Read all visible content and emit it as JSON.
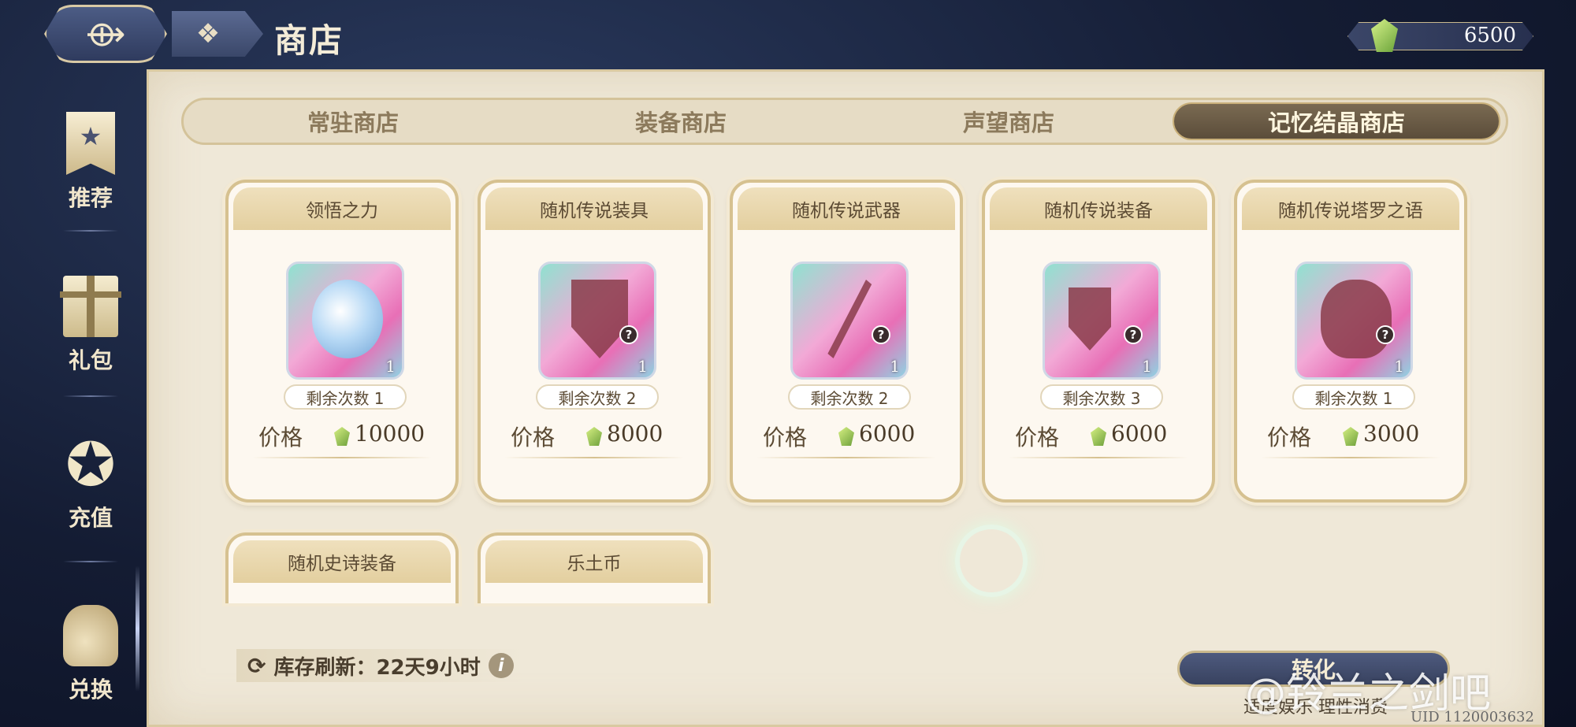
{
  "header": {
    "title": "商店",
    "back_icon": "back-arrow-icon",
    "menu_icon": "grid-icon",
    "currency": {
      "icon": "crystal-icon",
      "value": "6500",
      "color": "#9fd05a"
    }
  },
  "sidebar": {
    "items": [
      {
        "label": "推荐",
        "icon": "star-banner-icon"
      },
      {
        "label": "礼包",
        "icon": "gift-icon"
      },
      {
        "label": "充值",
        "icon": "sparkle-star-icon"
      },
      {
        "label": "兑换",
        "icon": "money-bag-icon"
      }
    ],
    "active_index": 3
  },
  "tabs": [
    {
      "label": "常驻商店",
      "active": false
    },
    {
      "label": "装备商店",
      "active": false
    },
    {
      "label": "声望商店",
      "active": false
    },
    {
      "label": "记忆结晶商店",
      "active": true
    }
  ],
  "cards": [
    {
      "name": "领悟之力",
      "icon": "crystal-orb-icon",
      "count": "1",
      "remaining": "剩余次数 1",
      "price_label": "价格",
      "price": "10000"
    },
    {
      "name": "随机传说装具",
      "icon": "mystery-shield-icon",
      "count": "1",
      "remaining": "剩余次数 2",
      "price_label": "价格",
      "price": "8000"
    },
    {
      "name": "随机传说武器",
      "icon": "mystery-sword-icon",
      "count": "1",
      "remaining": "剩余次数 2",
      "price_label": "价格",
      "price": "6000"
    },
    {
      "name": "随机传说装备",
      "icon": "mystery-equipment-icon",
      "count": "1",
      "remaining": "剩余次数 3",
      "price_label": "价格",
      "price": "6000"
    },
    {
      "name": "随机传说塔罗之语",
      "icon": "mystery-tarot-icon",
      "count": "1",
      "remaining": "剩余次数 1",
      "price_label": "价格",
      "price": "3000"
    }
  ],
  "cards_row2": [
    {
      "name": "随机史诗装备"
    },
    {
      "name": "乐土币"
    }
  ],
  "footer": {
    "refresh_text": "库存刷新：22天9小时",
    "convert_label": "转化",
    "notice": "适度娱乐 理性消费",
    "uid": "UID 1120003632",
    "watermark": "@铃兰之剑吧"
  }
}
